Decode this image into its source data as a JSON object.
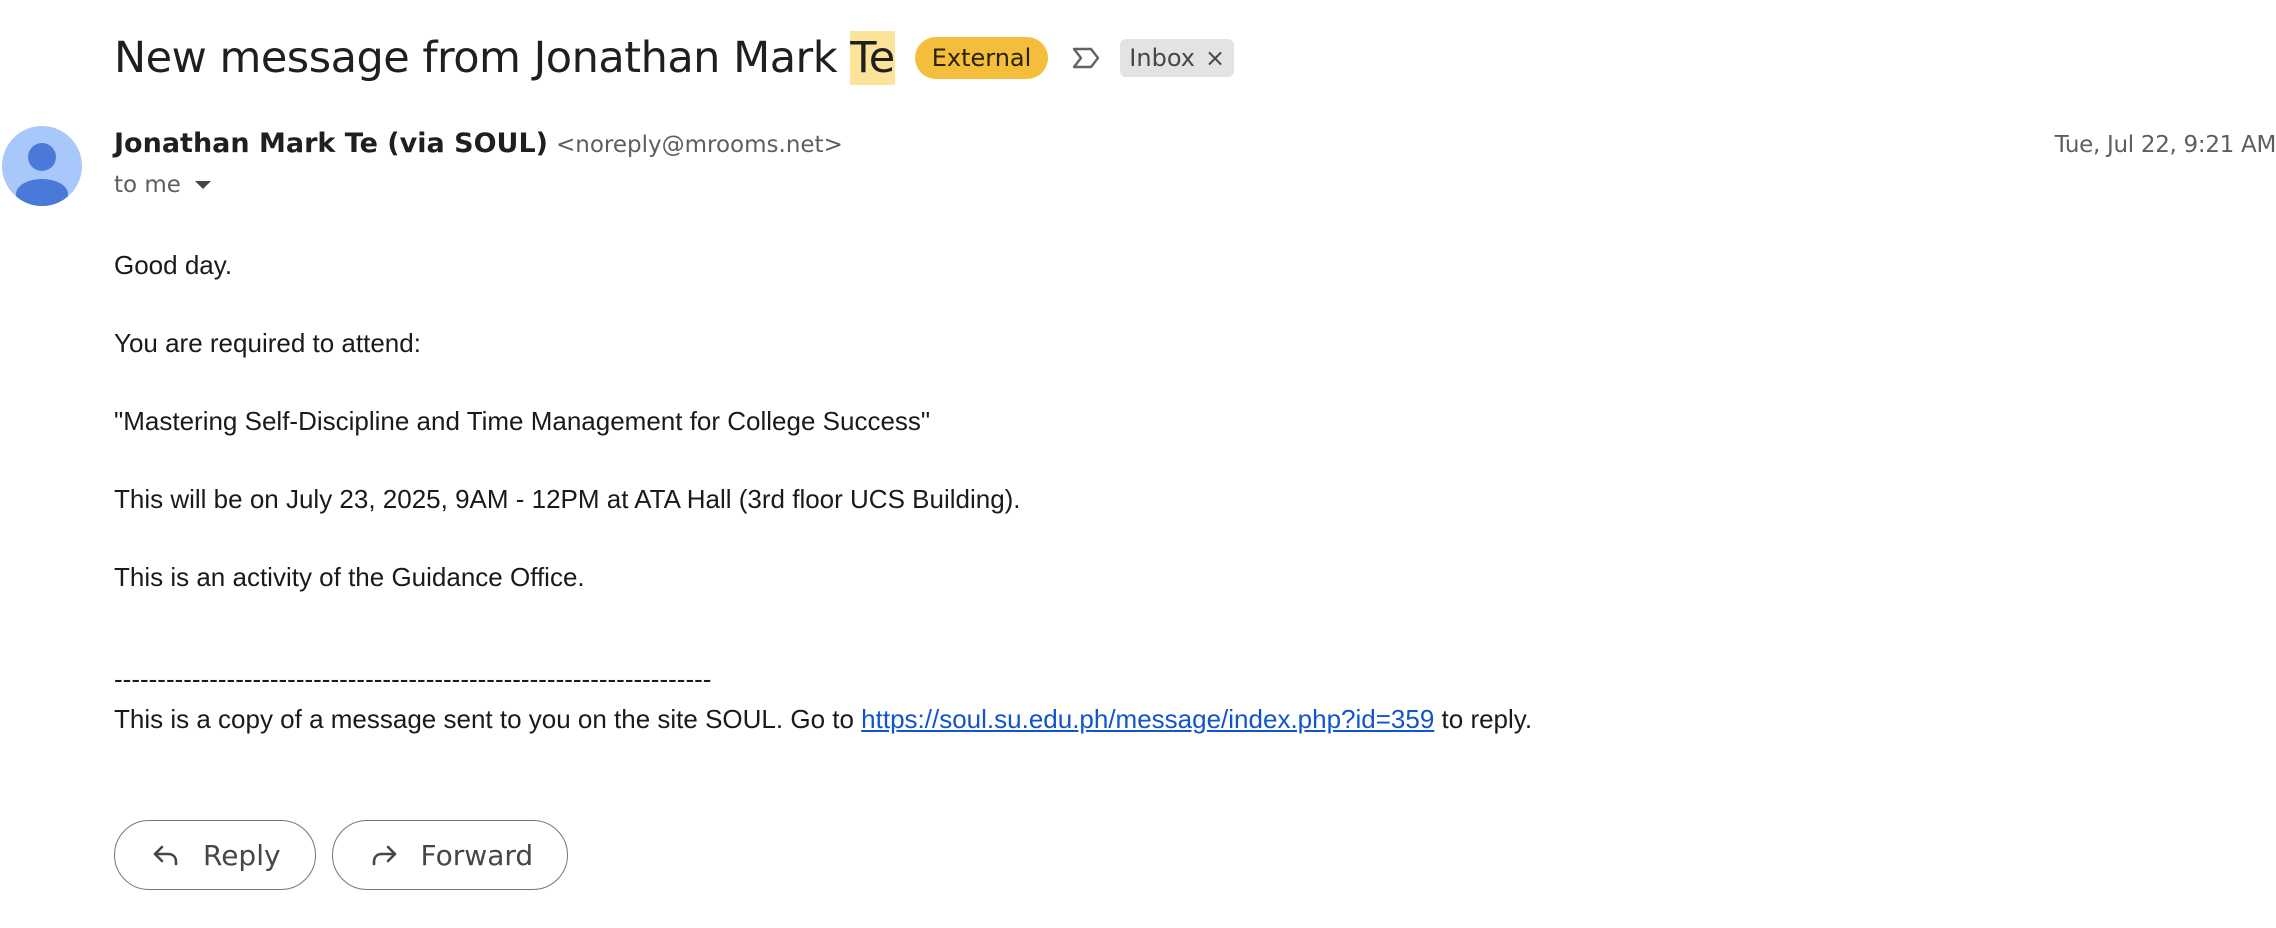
{
  "subject": {
    "text": "New message from Jonathan Mark ",
    "highlighted": "Te",
    "external_badge": "External",
    "importance_icon": "importance-marker-icon",
    "label": "Inbox",
    "label_remove": "×"
  },
  "sender": {
    "name": "Jonathan Mark Te (via SOUL)",
    "email": "<noreply@mrooms.net>",
    "timestamp": "Tue, Jul 22, 9:21 AM",
    "recipient": "to me"
  },
  "message": {
    "greeting": "Good day.",
    "line1": "You are required to attend:",
    "title": "\"Mastering Self-Discipline and Time Management for College Success\"",
    "schedule": "This will be on July 23, 2025, 9AM - 12PM at ATA Hall (3rd floor UCS Building).",
    "activity": "This is an activity of the Guidance Office.",
    "divider": "---------------------------------------------------------------------",
    "footer_prefix": "This is a copy of a message sent to you on the site SOUL. Go to ",
    "footer_link": "https://soul.su.edu.ph/message/index.php?id=359",
    "footer_suffix": " to reply."
  },
  "actions": {
    "reply_label": "Reply",
    "forward_label": "Forward"
  },
  "colors": {
    "highlight": "#fbe49a",
    "external_badge": "#f4bd3c",
    "avatar": "#a8c7fa",
    "avatar_figure": "#4a79d9",
    "link": "#1155cc"
  }
}
